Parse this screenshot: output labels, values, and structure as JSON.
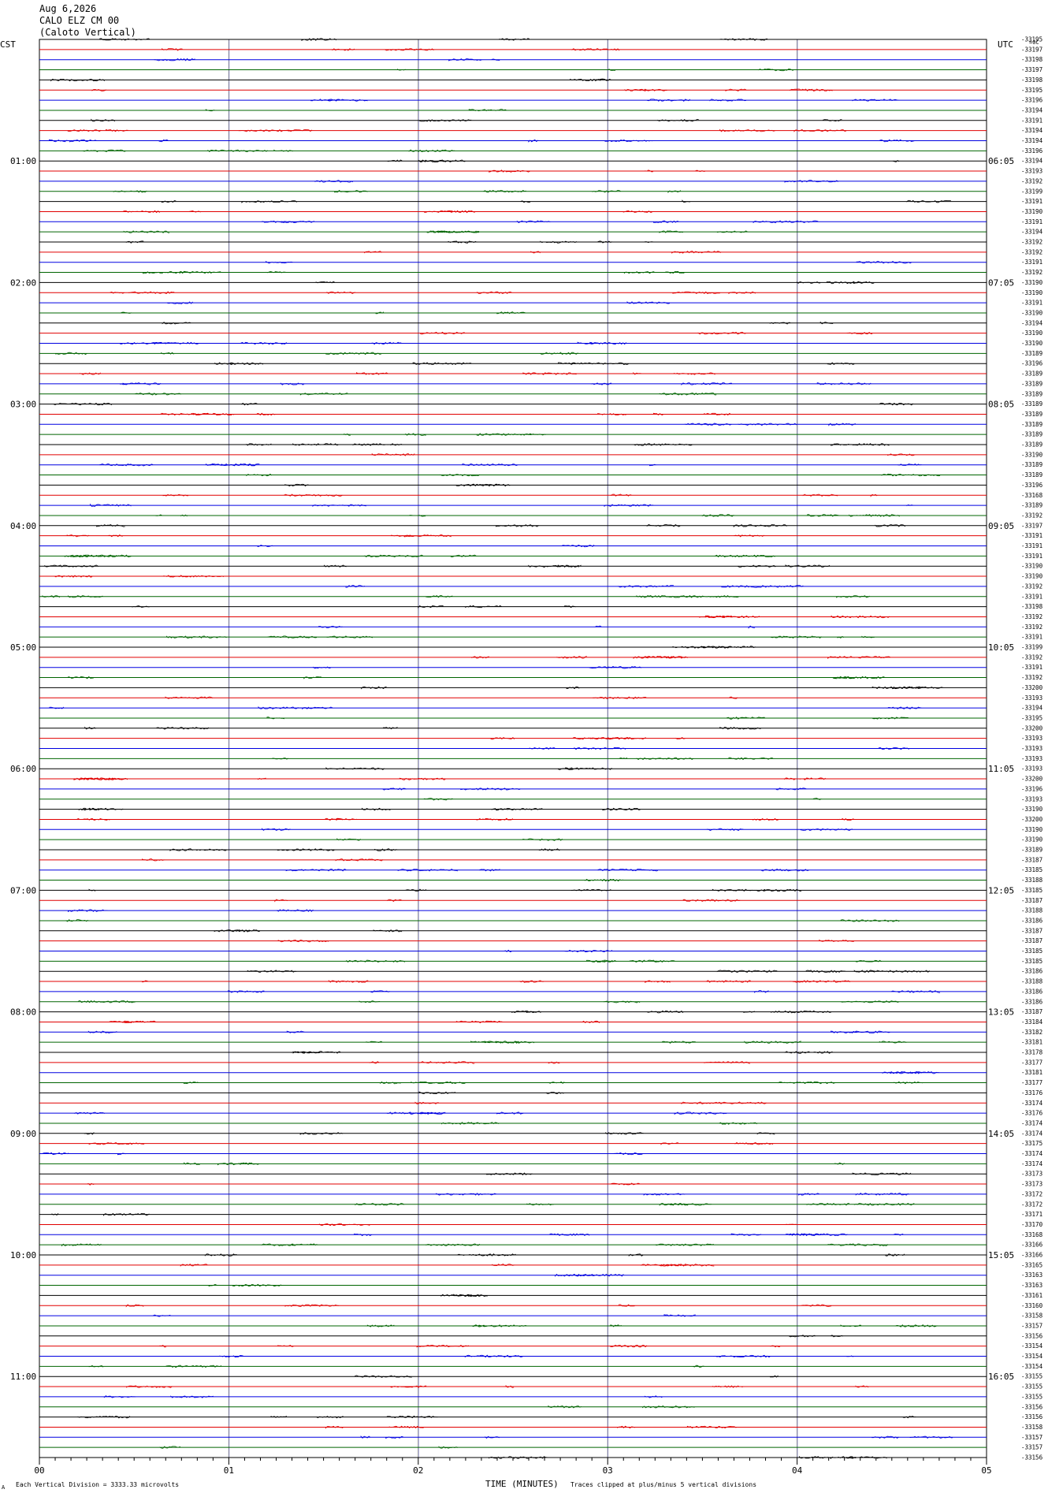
{
  "header": {
    "date": "Aug 6,2026",
    "station": "CALO ELZ CM 00",
    "location": "(Caloto Vertical)"
  },
  "left_zone": "CST",
  "right_zone": "UTC",
  "right_top": "=0C",
  "footer": {
    "marker": "A",
    "scale_note": "Each Vertical Division = 3333.33 microvolts",
    "xlabel": "TIME (MINUTES)",
    "clip_note": "Traces clipped at plus/minus 5 vertical divisions"
  },
  "colors": {
    "black": "#000000",
    "red": "#e00000",
    "blue": "#0000e0",
    "green": "#006400",
    "grid": "#808080",
    "gridBlue": "#6b6bd6"
  },
  "chart_data": {
    "type": "line",
    "title": "Aug 6,2026",
    "xlabel": "TIME (MINUTES)",
    "ylabel": "",
    "xlim": [
      0,
      5
    ],
    "x_ticks": [
      "00",
      "01",
      "02",
      "03",
      "04",
      "05"
    ],
    "trace_color_cycle": [
      "black",
      "red",
      "blue",
      "green"
    ],
    "left_hour_labels": [
      "01:00",
      "02:00",
      "03:00",
      "04:00",
      "05:00",
      "06:00",
      "07:00",
      "08:00",
      "09:00",
      "10:00",
      "11:00"
    ],
    "right_hour_labels": [
      "06:05",
      "07:05",
      "08:05",
      "09:05",
      "10:05",
      "11:05",
      "12:05",
      "13:05",
      "14:05",
      "15:05",
      "16:05"
    ],
    "hour_label_first_trace": 12,
    "hour_label_every": 12,
    "trace_values": [
      -33195,
      -33197,
      -33198,
      -33197,
      -33198,
      -33195,
      -33196,
      -33194,
      -33191,
      -33194,
      -33194,
      -33196,
      -33194,
      -33193,
      -33192,
      -33199,
      -33191,
      -33190,
      -33191,
      -33194,
      -33192,
      -33192,
      -33191,
      -33192,
      -33190,
      -33190,
      -33191,
      -33190,
      -33194,
      -33190,
      -33190,
      -33189,
      -33196,
      -33189,
      -33189,
      -33189,
      -33189,
      -33189,
      -33189,
      -33189,
      -33189,
      -33190,
      -33189,
      -33189,
      -33196,
      -33168,
      -33189,
      -33192,
      -33197,
      -33191,
      -33191,
      -33191,
      -33190,
      -33190,
      -33192,
      -33191,
      -33198,
      -33192,
      -33192,
      -33191,
      -33199,
      -33192,
      -33191,
      -33192,
      -33200,
      -33193,
      -33194,
      -33195,
      -33200,
      -33193,
      -33193,
      -33193,
      -33193,
      -33200,
      -33196,
      -33193,
      -33190,
      -33200,
      -33190,
      -33190,
      -33189,
      -33187,
      -33185,
      -33188,
      -33185,
      -33187,
      -33188,
      -33186,
      -33187,
      -33187,
      -33185,
      -33185,
      -33186,
      -33188,
      -33186,
      -33186,
      -33187,
      -33184,
      -33182,
      -33181,
      -33178,
      -33177,
      -33181,
      -33177,
      -33176,
      -33174,
      -33176,
      -33174,
      -33174,
      -33175,
      -33174,
      -33174,
      -33173,
      -33173,
      -33172,
      -33172,
      -33171,
      -33170,
      -33168,
      -33166,
      -33166,
      -33165,
      -33163,
      -33163,
      -33161,
      -33160,
      -33158,
      -33157,
      -33156,
      -33154,
      -33154,
      -33154,
      -33155,
      -33155,
      -33155,
      -33156,
      -33156,
      -33158,
      -33157,
      -33157,
      -33156
    ]
  }
}
